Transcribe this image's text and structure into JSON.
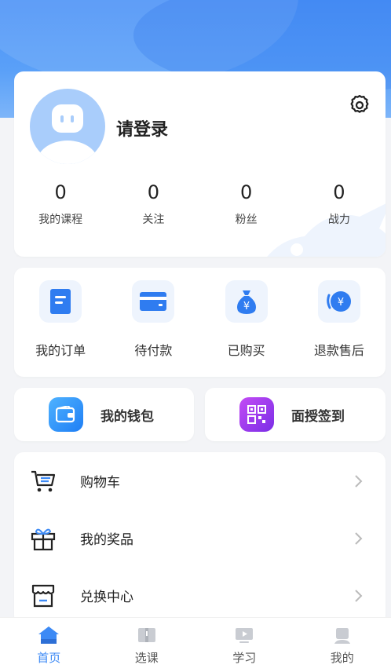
{
  "profile": {
    "login_text": "请登录",
    "stats": [
      {
        "value": "0",
        "label": "我的课程"
      },
      {
        "value": "0",
        "label": "关注"
      },
      {
        "value": "0",
        "label": "粉丝"
      },
      {
        "value": "0",
        "label": "战力"
      }
    ]
  },
  "orders": [
    {
      "label": "我的订单",
      "icon": "order-list-icon"
    },
    {
      "label": "待付款",
      "icon": "card-icon"
    },
    {
      "label": "已购买",
      "icon": "money-bag-icon"
    },
    {
      "label": "退款售后",
      "icon": "refund-icon"
    }
  ],
  "quick": {
    "wallet": "我的钱包",
    "checkin": "面授签到"
  },
  "menu": [
    {
      "label": "购物车",
      "icon": "cart-icon"
    },
    {
      "label": "我的奖品",
      "icon": "gift-icon"
    },
    {
      "label": "兑换中心",
      "icon": "store-icon"
    }
  ],
  "tabs": [
    {
      "label": "首页",
      "icon": "home-icon",
      "active": true
    },
    {
      "label": "选课",
      "icon": "book-icon",
      "active": false
    },
    {
      "label": "学习",
      "icon": "video-icon",
      "active": false
    },
    {
      "label": "我的",
      "icon": "user-icon",
      "active": false
    }
  ],
  "colors": {
    "accent": "#3d8af5",
    "header": "#4d93f7"
  }
}
